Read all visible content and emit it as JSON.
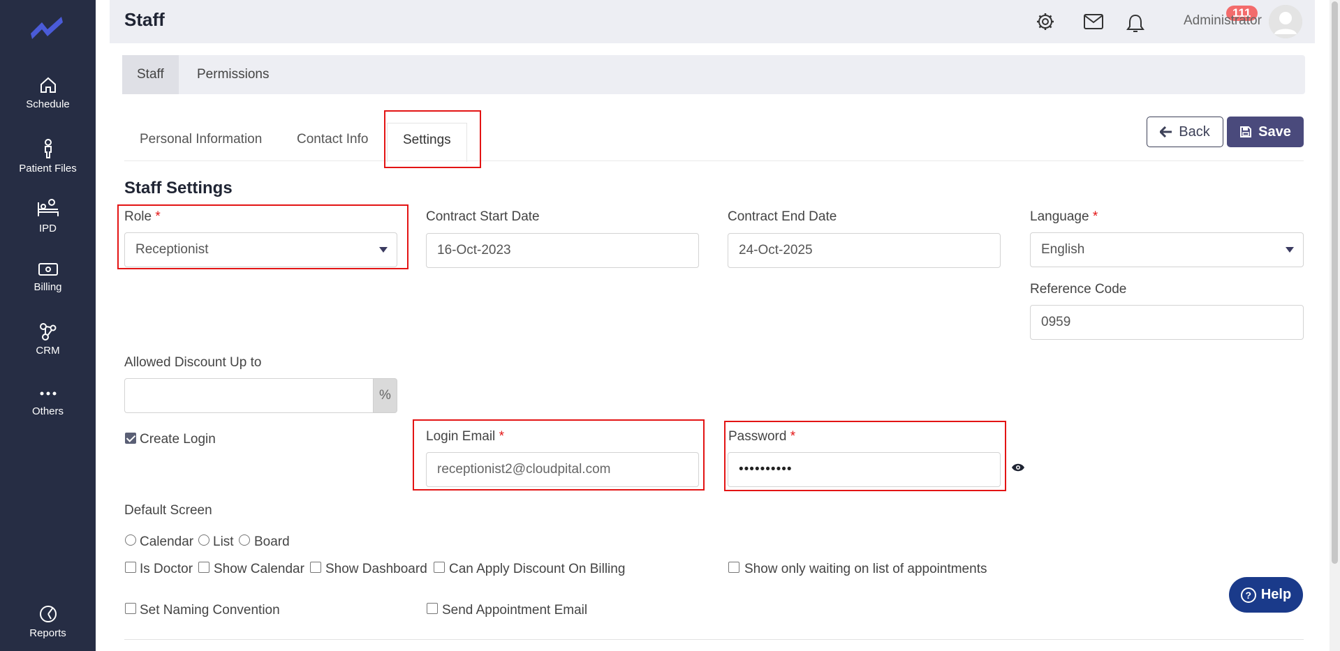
{
  "sidebar": {
    "items": [
      {
        "label": "Schedule",
        "icon": "home-icon"
      },
      {
        "label": "Patient Files",
        "icon": "person-icon"
      },
      {
        "label": "IPD",
        "icon": "bed-icon"
      },
      {
        "label": "Billing",
        "icon": "money-icon"
      },
      {
        "label": "CRM",
        "icon": "network-icon"
      },
      {
        "label": "Others",
        "icon": "more-icon"
      },
      {
        "label": "Reports",
        "icon": "pie-chart-icon"
      }
    ]
  },
  "header": {
    "title": "Staff",
    "notification_count": "111",
    "user_name": "Administrator"
  },
  "top_tabs": [
    "Staff",
    "Permissions"
  ],
  "sub_tabs": [
    "Personal Information",
    "Contact Info",
    "Settings"
  ],
  "actions": {
    "back_label": "Back",
    "save_label": "Save"
  },
  "section_title": "Staff Settings",
  "form": {
    "role": {
      "label": "Role",
      "value": "Receptionist"
    },
    "contract_start": {
      "label": "Contract Start Date",
      "value": "16-Oct-2023"
    },
    "contract_end": {
      "label": "Contract End Date",
      "value": "24-Oct-2025"
    },
    "language": {
      "label": "Language",
      "value": "English"
    },
    "reference_code": {
      "label": "Reference Code",
      "value": "0959"
    },
    "allowed_discount": {
      "label": "Allowed Discount Up to",
      "value": "",
      "suffix": "%"
    },
    "create_login": {
      "label": "Create Login",
      "checked": true
    },
    "login_email": {
      "label": "Login Email",
      "value": "receptionist2@cloudpital.com"
    },
    "password": {
      "label": "Password",
      "value": "••••••••••"
    },
    "default_screen": {
      "label": "Default Screen",
      "options": [
        "Calendar",
        "List",
        "Board"
      ]
    },
    "flags": {
      "is_doctor": "Is Doctor",
      "show_calendar": "Show Calendar",
      "show_dashboard": "Show Dashboard",
      "can_apply_discount": "Can Apply Discount On Billing",
      "show_only_waiting": "Show only waiting on list of appointments",
      "set_naming_convention": "Set Naming Convention",
      "send_appointment_email": "Send Appointment Email"
    },
    "required_mark": "*"
  },
  "help": {
    "label": "Help",
    "glyph": "?"
  },
  "colors": {
    "sidebar": "#262d44",
    "accent": "#4a4a7c",
    "highlight": "#e31414",
    "help": "#1a3a8a"
  }
}
